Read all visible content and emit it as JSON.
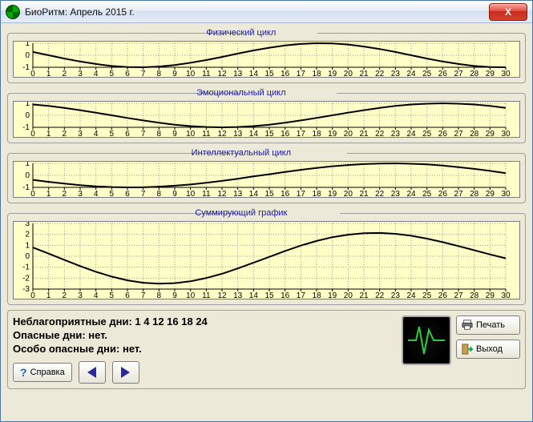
{
  "window": {
    "title": "БиоРитм: Апрель 2015 г.",
    "close_label": "X"
  },
  "charts": {
    "physical": {
      "title": "Физический цикл"
    },
    "emotional": {
      "title": "Эмоциональный цикл"
    },
    "intellect": {
      "title": "Интеллектуальный цикл"
    },
    "summary": {
      "title": "Суммирующий график"
    }
  },
  "info": {
    "bad_days_label": "Неблагоприятные дни:",
    "bad_days_value": "1 4 12 16 18 24",
    "danger_label": "Опасные дни:",
    "danger_value": "нет.",
    "extra_danger_label": "Особо опасные дни:",
    "extra_danger_value": "нет."
  },
  "buttons": {
    "help": "Справка",
    "print": "Печать",
    "exit": "Выход"
  },
  "chart_data": [
    {
      "id": "physical",
      "type": "line",
      "title": "Физический цикл",
      "xlabel": "",
      "ylabel": "",
      "x": [
        0,
        1,
        2,
        3,
        4,
        5,
        6,
        7,
        8,
        9,
        10,
        11,
        12,
        13,
        14,
        15,
        16,
        17,
        18,
        19,
        20,
        21,
        22,
        23,
        24,
        25,
        26,
        27,
        28,
        29,
        30
      ],
      "values": [
        0.27,
        0.0,
        -0.27,
        -0.52,
        -0.73,
        -0.89,
        -0.98,
        -1.0,
        -0.94,
        -0.82,
        -0.63,
        -0.4,
        -0.14,
        0.14,
        0.4,
        0.63,
        0.82,
        0.94,
        1.0,
        0.98,
        0.89,
        0.73,
        0.52,
        0.27,
        0.0,
        -0.27,
        -0.52,
        -0.73,
        -0.89,
        -0.98,
        -1.0
      ],
      "ylim": [
        -1,
        1
      ],
      "xrange": [
        0,
        30
      ],
      "xticks": [
        0,
        1,
        2,
        3,
        4,
        5,
        6,
        7,
        8,
        9,
        10,
        11,
        12,
        13,
        14,
        15,
        16,
        17,
        18,
        19,
        20,
        21,
        22,
        23,
        24,
        25,
        26,
        27,
        28,
        29,
        30
      ]
    },
    {
      "id": "emotional",
      "type": "line",
      "title": "Эмоциональный цикл",
      "xlabel": "",
      "ylabel": "",
      "x": [
        0,
        1,
        2,
        3,
        4,
        5,
        6,
        7,
        8,
        9,
        10,
        11,
        12,
        13,
        14,
        15,
        16,
        17,
        18,
        19,
        20,
        21,
        22,
        23,
        24,
        25,
        26,
        27,
        28,
        29,
        30
      ],
      "values": [
        0.9,
        0.78,
        0.62,
        0.43,
        0.22,
        0.0,
        -0.22,
        -0.43,
        -0.62,
        -0.78,
        -0.9,
        -0.97,
        -1.0,
        -0.97,
        -0.9,
        -0.78,
        -0.62,
        -0.43,
        -0.22,
        0.0,
        0.22,
        0.43,
        0.62,
        0.78,
        0.9,
        0.97,
        1.0,
        0.97,
        0.9,
        0.78,
        0.62
      ],
      "ylim": [
        -1,
        1
      ],
      "xrange": [
        0,
        30
      ],
      "xticks": [
        0,
        1,
        2,
        3,
        4,
        5,
        6,
        7,
        8,
        9,
        10,
        11,
        12,
        13,
        14,
        15,
        16,
        17,
        18,
        19,
        20,
        21,
        22,
        23,
        24,
        25,
        26,
        27,
        28,
        29,
        30
      ]
    },
    {
      "id": "intellect",
      "type": "line",
      "title": "Интеллектуальный цикл",
      "xlabel": "",
      "ylabel": "",
      "x": [
        0,
        1,
        2,
        3,
        4,
        5,
        6,
        7,
        8,
        9,
        10,
        11,
        12,
        13,
        14,
        15,
        16,
        17,
        18,
        19,
        20,
        21,
        22,
        23,
        24,
        25,
        26,
        27,
        28,
        29,
        30
      ],
      "values": [
        -0.37,
        -0.54,
        -0.69,
        -0.81,
        -0.91,
        -0.97,
        -1.0,
        -0.99,
        -0.94,
        -0.86,
        -0.76,
        -0.62,
        -0.46,
        -0.28,
        -0.09,
        0.09,
        0.28,
        0.46,
        0.62,
        0.76,
        0.86,
        0.94,
        0.99,
        1.0,
        0.97,
        0.91,
        0.81,
        0.69,
        0.54,
        0.37,
        0.19
      ],
      "ylim": [
        -1,
        1
      ],
      "xrange": [
        0,
        30
      ],
      "xticks": [
        0,
        1,
        2,
        3,
        4,
        5,
        6,
        7,
        8,
        9,
        10,
        11,
        12,
        13,
        14,
        15,
        16,
        17,
        18,
        19,
        20,
        21,
        22,
        23,
        24,
        25,
        26,
        27,
        28,
        29,
        30
      ]
    },
    {
      "id": "summary",
      "type": "line",
      "title": "Суммирующий график",
      "xlabel": "",
      "ylabel": "",
      "x": [
        0,
        1,
        2,
        3,
        4,
        5,
        6,
        7,
        8,
        9,
        10,
        11,
        12,
        13,
        14,
        15,
        16,
        17,
        18,
        19,
        20,
        21,
        22,
        23,
        24,
        25,
        26,
        27,
        28,
        29,
        30
      ],
      "values": [
        0.8,
        0.24,
        -0.34,
        -0.9,
        -1.42,
        -1.86,
        -2.2,
        -2.42,
        -2.5,
        -2.46,
        -2.29,
        -1.99,
        -1.6,
        -1.11,
        -0.59,
        -0.06,
        0.48,
        0.97,
        1.4,
        1.74,
        1.97,
        2.1,
        2.13,
        2.05,
        1.87,
        1.61,
        1.29,
        0.93,
        0.55,
        0.17,
        -0.19
      ],
      "ylim": [
        -3,
        3
      ],
      "xrange": [
        0,
        30
      ],
      "xticks": [
        0,
        1,
        2,
        3,
        4,
        5,
        6,
        7,
        8,
        9,
        10,
        11,
        12,
        13,
        14,
        15,
        16,
        17,
        18,
        19,
        20,
        21,
        22,
        23,
        24,
        25,
        26,
        27,
        28,
        29,
        30
      ]
    }
  ]
}
